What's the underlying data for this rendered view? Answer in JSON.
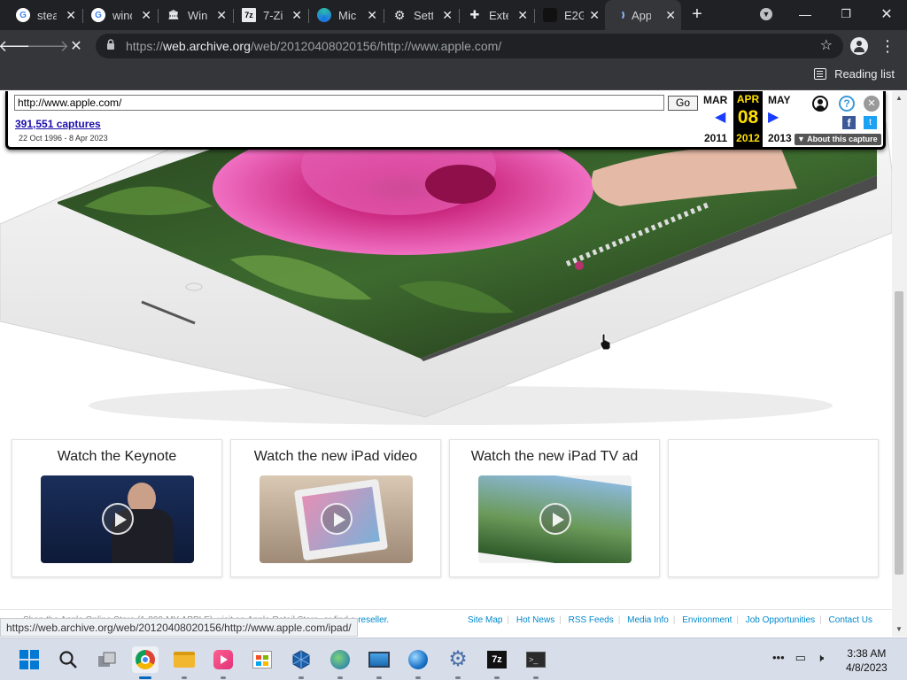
{
  "browser": {
    "tabs": [
      {
        "icon": "google-icon",
        "label": "stea",
        "color": "#4285f4"
      },
      {
        "icon": "google-icon",
        "label": "wind",
        "color": "#4285f4"
      },
      {
        "icon": "archive-icon",
        "label": "Win",
        "color": "#cfd1d4"
      },
      {
        "icon": "7zip-icon",
        "label": "7-Zi",
        "color": "#ffffff"
      },
      {
        "icon": "edge-icon",
        "label": "Mic",
        "color": "#2ab7a9"
      },
      {
        "icon": "gear-icon",
        "label": "Sett",
        "color": "#e8eaed"
      },
      {
        "icon": "puzzle-icon",
        "label": "Exte",
        "color": "#e8eaed"
      },
      {
        "icon": "e2g-icon",
        "label": "E2G",
        "color": "#333333"
      },
      {
        "icon": "loading-icon",
        "label": "App",
        "color": "#8ab4f8"
      }
    ],
    "url_prefix": "https://",
    "url_domain": "web.archive.org",
    "url_path": "/web/20120408020156/http://www.apple.com/",
    "reading_list": "Reading list"
  },
  "wayback": {
    "url_value": "http://www.apple.com/",
    "go": "Go",
    "captures": "391,551 captures",
    "range": "22 Oct 1996 - 8 Apr 2023",
    "prev_month": "MAR",
    "prev_year": "2011",
    "cur_month": "APR",
    "cur_day": "08",
    "cur_year": "2012",
    "next_month": "MAY",
    "next_year": "2013",
    "about": "About this capture"
  },
  "cards": [
    {
      "title": "Watch the Keynote"
    },
    {
      "title": "Watch the new iPad video"
    },
    {
      "title": "Watch the new iPad TV ad"
    }
  ],
  "footer": {
    "left_text": "Shop the Apple Online Store (1-800-MY-APPLE), visit an Apple Retail Store, or find a",
    "left_link": "reseller.",
    "links": [
      "Site Map",
      "Hot News",
      "RSS Feeds",
      "Media Info",
      "Environment",
      "Job Opportunities",
      "Contact Us"
    ]
  },
  "status_url": "https://web.archive.org/web/20120408020156/http://www.apple.com/ipad/",
  "taskbar": {
    "time": "3:38 AM",
    "date": "4/8/2023"
  },
  "colors": {
    "chrome_dark": "#202124",
    "chrome_toolbar": "#35363a",
    "wayback_yellow": "#ffe000",
    "link_blue": "#0088cc",
    "taskbar": "#d7dde9"
  }
}
